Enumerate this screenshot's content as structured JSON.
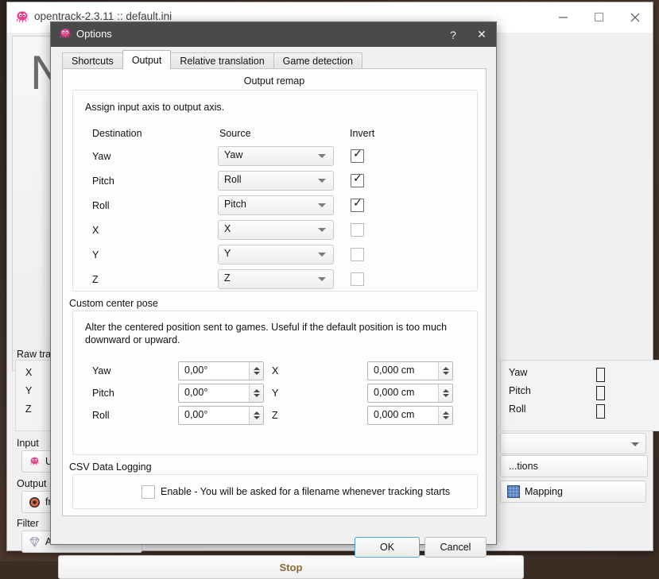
{
  "desktop": {
    "background_color": "#3b2d24"
  },
  "main_window": {
    "title": "opentrack-2.3.11 :: default.ini",
    "icon": "opentrack-octopus-icon",
    "controls": {
      "minimize": "minimize-icon",
      "maximize": "maximize-icon",
      "close": "close-icon"
    },
    "video_watermark": "N",
    "raw_tracker": {
      "legend": "Raw tracker",
      "rows": [
        "X",
        "Y",
        "Z"
      ]
    },
    "game_data": {
      "rows": [
        "Yaw",
        "Pitch",
        "Roll"
      ],
      "values": [
        "□",
        "□",
        "□"
      ]
    },
    "profile_combo": {
      "value": ""
    },
    "options_button": {
      "label": "...tions"
    },
    "mapping_button": {
      "label": "Mapping",
      "icon": "mapping-grid-icon"
    },
    "stop_button": {
      "label": "Stop"
    },
    "module_sections": [
      {
        "label": "Input",
        "value": "UDP",
        "icon": "opentrack-octopus-icon"
      },
      {
        "label": "Output",
        "value": "free",
        "icon": "freetrack-icon"
      },
      {
        "label": "Filter",
        "value": "Acc",
        "icon": "accela-diamond-icon"
      }
    ]
  },
  "options_dialog": {
    "title": "Options",
    "icon": "opentrack-octopus-icon",
    "help_button": "?",
    "close_button": "✕",
    "tabs": [
      {
        "label": "Shortcuts",
        "active": false
      },
      {
        "label": "Output",
        "active": true
      },
      {
        "label": "Relative translation",
        "active": false
      },
      {
        "label": "Game detection",
        "active": false
      }
    ],
    "output_remap": {
      "title": "Output remap",
      "description": "Assign input axis to output axis.",
      "columns": [
        "Destination",
        "Source",
        "Invert"
      ],
      "rows": [
        {
          "destination": "Yaw",
          "source": "Yaw",
          "invert": true
        },
        {
          "destination": "Pitch",
          "source": "Roll",
          "invert": true
        },
        {
          "destination": "Roll",
          "source": "Pitch",
          "invert": true
        },
        {
          "destination": "X",
          "source": "X",
          "invert": false
        },
        {
          "destination": "Y",
          "source": "Y",
          "invert": false
        },
        {
          "destination": "Z",
          "source": "Z",
          "invert": false
        }
      ]
    },
    "custom_center_pose": {
      "legend": "Custom center pose",
      "description": "Alter the centered position sent to games. Useful if the default position is too much downward or upward.",
      "rotation_rows": [
        {
          "label": "Yaw",
          "value": "0,00°"
        },
        {
          "label": "Pitch",
          "value": "0,00°"
        },
        {
          "label": "Roll",
          "value": "0,00°"
        }
      ],
      "translation_rows": [
        {
          "label": "X",
          "value": "0,000 cm"
        },
        {
          "label": "Y",
          "value": "0,000 cm"
        },
        {
          "label": "Z",
          "value": "0,000 cm"
        }
      ]
    },
    "csv_logging": {
      "legend": "CSV Data Logging",
      "checkbox_label": "Enable - You will be asked for a filename whenever tracking starts",
      "checked": false
    },
    "buttons": {
      "ok": "OK",
      "cancel": "Cancel"
    }
  }
}
